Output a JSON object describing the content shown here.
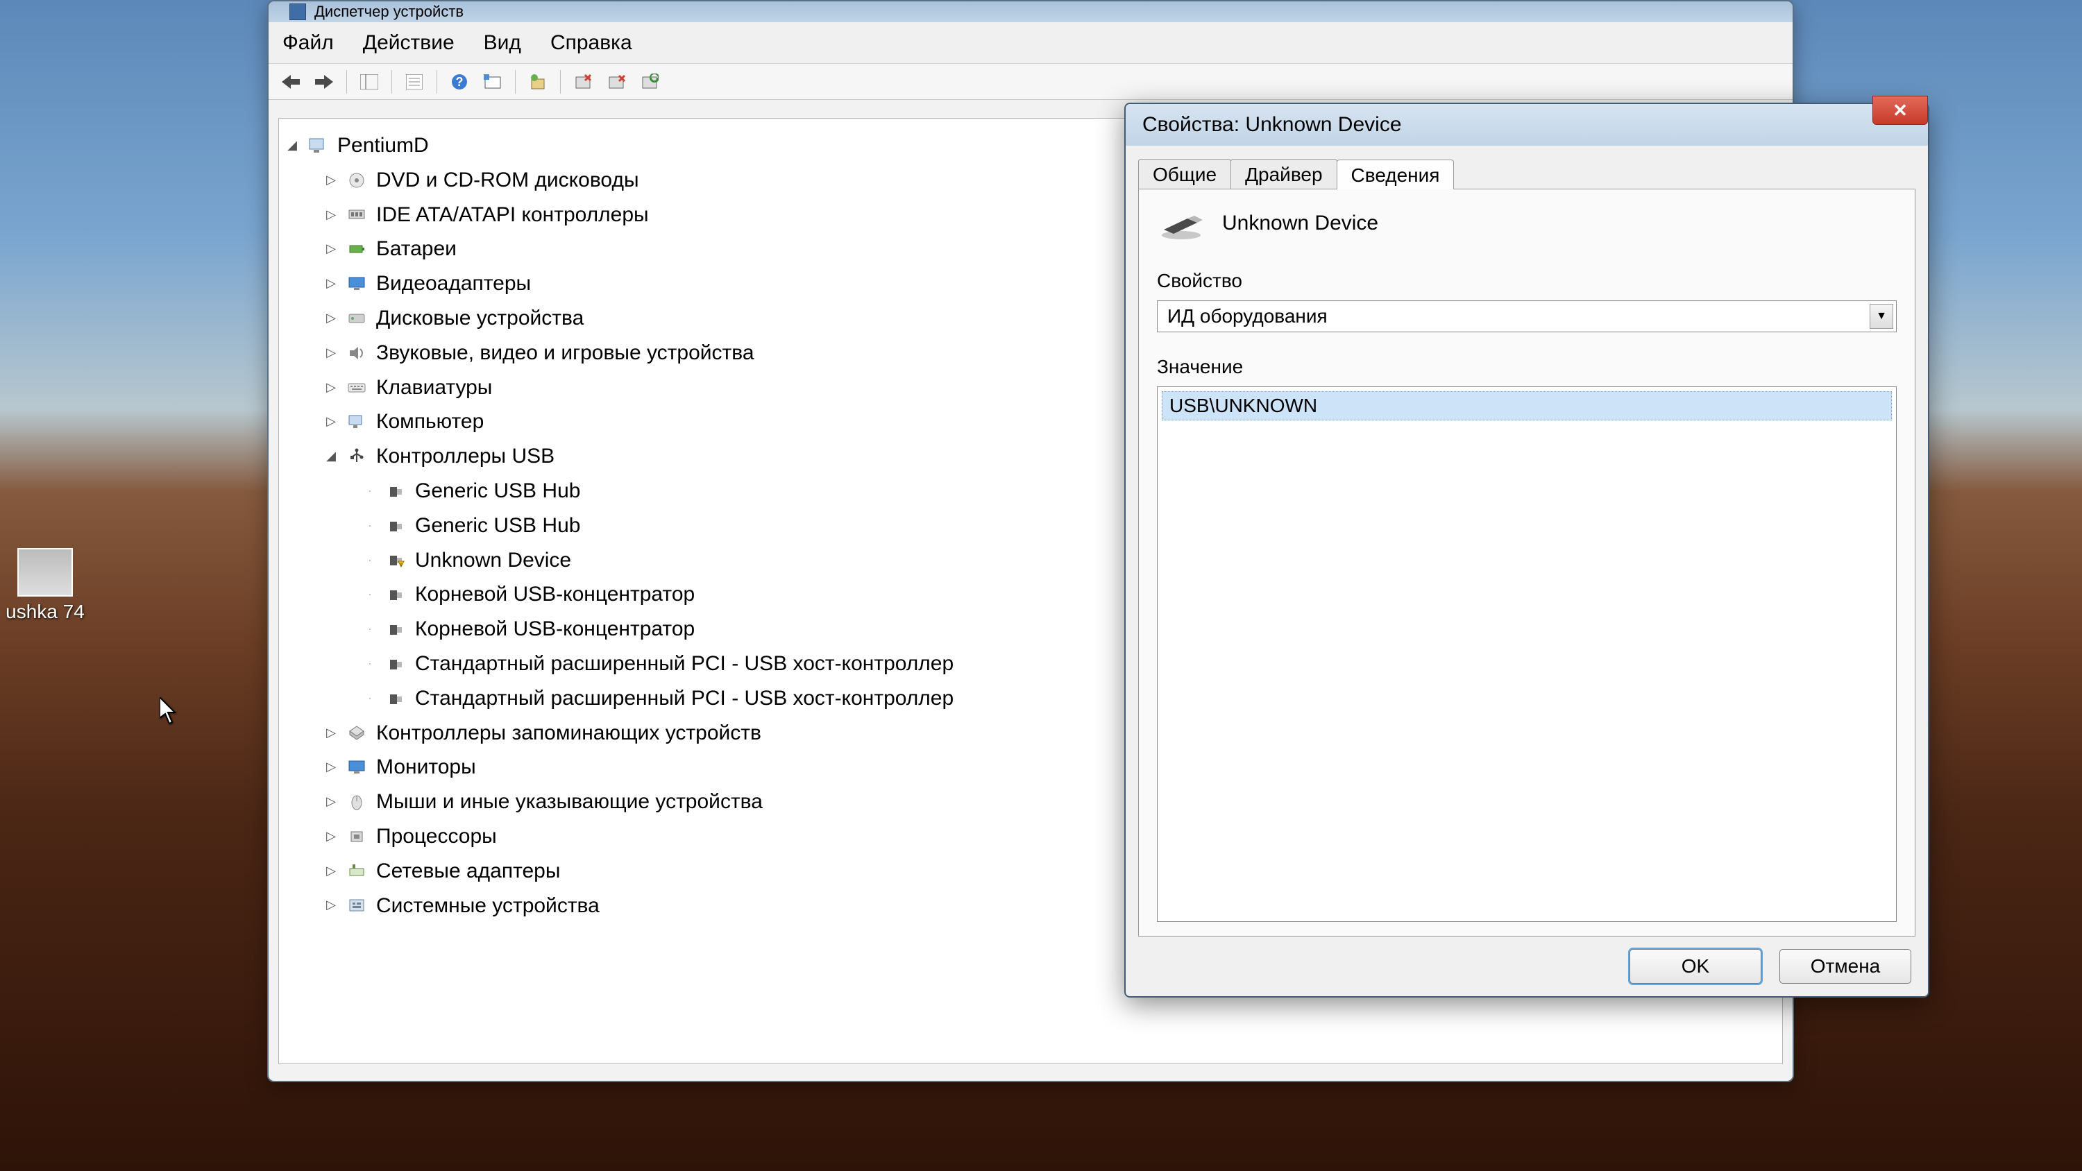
{
  "desktop": {
    "icon_label": "ushka 74"
  },
  "device_manager": {
    "title": "Диспетчер устройств",
    "menu": {
      "file": "Файл",
      "action": "Действие",
      "view": "Вид",
      "help": "Справка"
    },
    "root": "PentiumD",
    "categories": [
      {
        "label": "DVD и CD-ROM дисководы",
        "icon": "disc"
      },
      {
        "label": "IDE ATA/ATAPI контроллеры",
        "icon": "ide"
      },
      {
        "label": "Батареи",
        "icon": "battery"
      },
      {
        "label": "Видеоадаптеры",
        "icon": "display"
      },
      {
        "label": "Дисковые устройства",
        "icon": "hdd"
      },
      {
        "label": "Звуковые, видео и игровые устройства",
        "icon": "sound"
      },
      {
        "label": "Клавиатуры",
        "icon": "keyboard"
      },
      {
        "label": "Компьютер",
        "icon": "computer"
      },
      {
        "label": "Контроллеры USB",
        "icon": "usb",
        "expanded": true,
        "children": [
          {
            "label": "Generic USB Hub",
            "icon": "usbdev"
          },
          {
            "label": "Generic USB Hub",
            "icon": "usbdev"
          },
          {
            "label": "Unknown Device",
            "icon": "usbdev-warn"
          },
          {
            "label": "Корневой USB-концентратор",
            "icon": "usbdev"
          },
          {
            "label": "Корневой USB-концентратор",
            "icon": "usbdev"
          },
          {
            "label": "Стандартный расширенный PCI - USB хост-контроллер",
            "icon": "usbdev"
          },
          {
            "label": "Стандартный расширенный PCI - USB хост-контроллер",
            "icon": "usbdev"
          }
        ]
      },
      {
        "label": "Контроллеры запоминающих устройств",
        "icon": "storage"
      },
      {
        "label": "Мониторы",
        "icon": "monitor"
      },
      {
        "label": "Мыши и иные указывающие устройства",
        "icon": "mouse"
      },
      {
        "label": "Процессоры",
        "icon": "cpu"
      },
      {
        "label": "Сетевые адаптеры",
        "icon": "network"
      },
      {
        "label": "Системные устройства",
        "icon": "system"
      }
    ]
  },
  "properties": {
    "title": "Свойства: Unknown Device",
    "tabs": {
      "general": "Общие",
      "driver": "Драйвер",
      "details": "Сведения"
    },
    "device_name": "Unknown Device",
    "property_label": "Свойство",
    "property_value": "ИД оборудования",
    "value_label": "Значение",
    "value_rows": [
      "USB\\UNKNOWN"
    ],
    "ok": "OK",
    "cancel": "Отмена"
  }
}
